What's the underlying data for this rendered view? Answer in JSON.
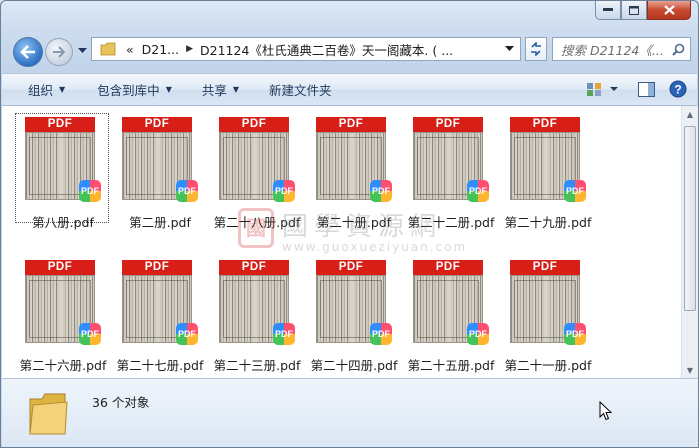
{
  "window": {
    "controls": {
      "minimize": "minimize",
      "maximize": "maximize",
      "close": "close"
    }
  },
  "address_bar": {
    "crumbs": [
      "«",
      "D21...",
      "D21124《杜氏通典二百卷》天一阁藏本. ( ..."
    ],
    "search_placeholder": "搜索 D21124《..."
  },
  "command_bar": {
    "organize": "组织",
    "include_in_library": "包含到库中",
    "share": "共享",
    "new_folder": "新建文件夹"
  },
  "files": [
    {
      "name": "第八册.pdf",
      "selected": true
    },
    {
      "name": "第二册.pdf"
    },
    {
      "name": "第二十八册.pdf"
    },
    {
      "name": "第二十册.pdf"
    },
    {
      "name": "第二十二册.pdf"
    },
    {
      "name": "第二十九册.pdf"
    },
    {
      "name": "第二十六册.pdf"
    },
    {
      "name": "第二十七册.pdf"
    },
    {
      "name": "第二十三册.pdf"
    },
    {
      "name": "第二十四册.pdf"
    },
    {
      "name": "第二十五册.pdf"
    },
    {
      "name": "第二十一册.pdf"
    }
  ],
  "thumbnail": {
    "banner": "PDF",
    "badge": "PDF",
    "banner_color": "#d71f18"
  },
  "watermark": {
    "seal": "國",
    "title": "國學資源網",
    "url": "www.guoxueziyuan.com"
  },
  "details": {
    "item_count": "36 个对象"
  }
}
